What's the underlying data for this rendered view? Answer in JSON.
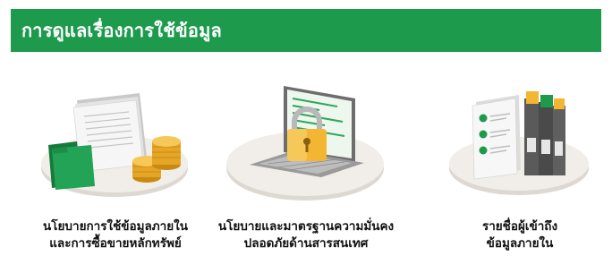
{
  "header": {
    "title": "การดูแลเรื่องการใช้ข้อมูล",
    "background": "#1d9a4c"
  },
  "cards": [
    {
      "icon": "documents-and-coins-icon",
      "line1": "นโยบายการใช้ข้อมูลภายใน",
      "line2": "และการซื้อขายหลักทรัพย์"
    },
    {
      "icon": "laptop-lock-icon",
      "line1": "นโยบายและมาตรฐานความมั่นคง",
      "line2": "ปลอดภัยด้านสารสนเทศ"
    },
    {
      "icon": "files-and-binders-icon",
      "line1": "รายชื่อผู้เข้าถึง",
      "line2": "ข้อมูลภายใน"
    }
  ]
}
